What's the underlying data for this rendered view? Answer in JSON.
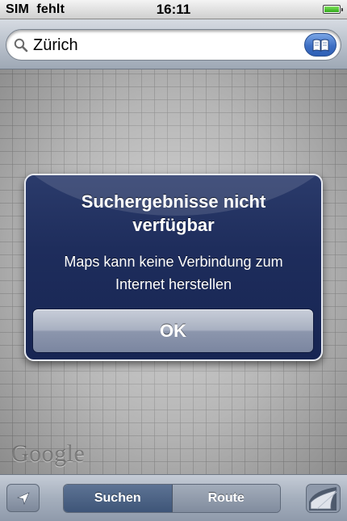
{
  "status_bar": {
    "carrier": "SIM  fehlt",
    "time": "16:11",
    "battery_level": 1.0,
    "battery_color": "#2ea818"
  },
  "search": {
    "value": "Zürich",
    "icon": "search-icon",
    "bookmarks_icon": "bookmarks-book-icon"
  },
  "map": {
    "provider_logo": "Google"
  },
  "alert": {
    "title": "Suchergebnisse nicht verfügbar",
    "message": "Maps kann keine Verbindung zum Internet herstellen",
    "ok_label": "OK"
  },
  "toolbar": {
    "locate_icon": "location-arrow-icon",
    "segments": [
      {
        "label": "Suchen",
        "selected": true
      },
      {
        "label": "Route",
        "selected": false
      }
    ],
    "page_curl_icon": "page-curl-icon"
  },
  "colors": {
    "alert_background": "#1e2d5c",
    "selected_segment": "#4a6086",
    "bookmarks_button": "#3e6fc4"
  }
}
